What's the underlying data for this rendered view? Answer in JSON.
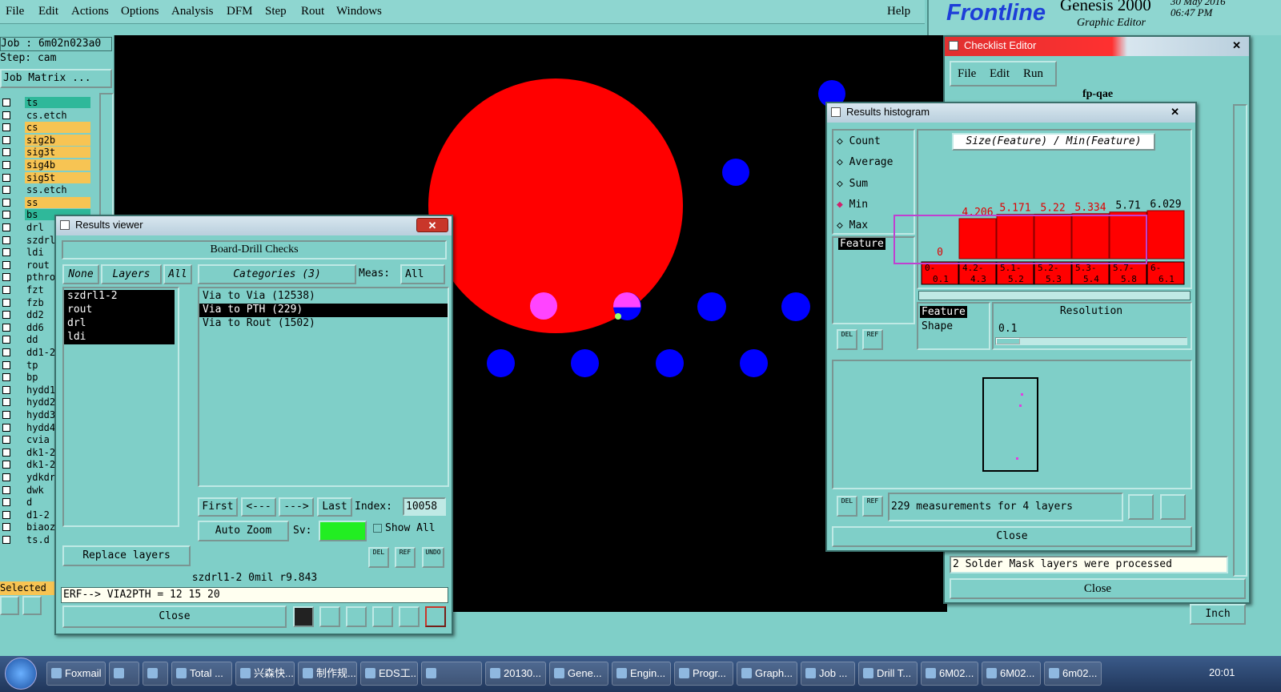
{
  "menu": [
    "File",
    "Edit",
    "Actions",
    "Options",
    "Analysis",
    "DFM",
    "Step",
    "Rout",
    "Windows"
  ],
  "help": "Help",
  "logo": {
    "brand": "Frontline",
    "product": "Genesis 2000",
    "subtitle": "Graphic Editor",
    "date": "30 May 2016",
    "time": "06:47 PM"
  },
  "job": {
    "job_label": "Job : 6m02n023a0",
    "step_label": "Step: cam",
    "matrix_btn": "Job Matrix ..."
  },
  "layers": [
    {
      "name": "ts",
      "color": "#2fb89a"
    },
    {
      "name": "cs.etch",
      "color": "#7fcfc8"
    },
    {
      "name": "cs",
      "color": "#f7c453"
    },
    {
      "name": "sig2b",
      "color": "#f7c453"
    },
    {
      "name": "sig3t",
      "color": "#f7c453"
    },
    {
      "name": "sig4b",
      "color": "#f7c453"
    },
    {
      "name": "sig5t",
      "color": "#f7c453"
    },
    {
      "name": "ss.etch",
      "color": "#7fcfc8"
    },
    {
      "name": "ss",
      "color": "#f7c453"
    },
    {
      "name": "bs",
      "color": "#2fb89a"
    },
    {
      "name": "drl",
      "color": "#7fcfc8"
    },
    {
      "name": "szdrl",
      "color": "#7fcfc8"
    },
    {
      "name": "ldi",
      "color": "#7fcfc8"
    },
    {
      "name": "rout",
      "color": "#7fcfc8"
    },
    {
      "name": "pthro",
      "color": "#7fcfc8"
    },
    {
      "name": "fzt",
      "color": "#7fcfc8"
    },
    {
      "name": "fzb",
      "color": "#7fcfc8"
    },
    {
      "name": "dd2",
      "color": "#7fcfc8"
    },
    {
      "name": "dd6",
      "color": "#7fcfc8"
    },
    {
      "name": "dd",
      "color": "#7fcfc8"
    },
    {
      "name": "dd1-2",
      "color": "#7fcfc8"
    },
    {
      "name": "tp",
      "color": "#7fcfc8"
    },
    {
      "name": "bp",
      "color": "#7fcfc8"
    },
    {
      "name": "hydd1",
      "color": "#7fcfc8"
    },
    {
      "name": "hydd2",
      "color": "#7fcfc8"
    },
    {
      "name": "hydd3",
      "color": "#7fcfc8"
    },
    {
      "name": "hydd4",
      "color": "#7fcfc8"
    },
    {
      "name": "cvia",
      "color": "#7fcfc8"
    },
    {
      "name": "dk1-2",
      "color": "#7fcfc8"
    },
    {
      "name": "dk1-2",
      "color": "#7fcfc8"
    },
    {
      "name": "ydkdr",
      "color": "#7fcfc8"
    },
    {
      "name": "dwk",
      "color": "#7fcfc8"
    },
    {
      "name": "d",
      "color": "#7fcfc8"
    },
    {
      "name": "d1-2",
      "color": "#7fcfc8"
    },
    {
      "name": "biaoz",
      "color": "#7fcfc8"
    },
    {
      "name": "ts.d",
      "color": "#7fcfc8"
    }
  ],
  "selected_label": "Selected :",
  "results_viewer": {
    "title": "Results viewer",
    "header": "Board-Drill Checks",
    "none": "None",
    "layers": "Layers",
    "all": "All",
    "layer_items": [
      "szdrl1-2",
      "rout",
      "drl",
      "ldi"
    ],
    "categories": "Categories (3)",
    "meas_label": "Meas:",
    "meas_value": "All",
    "category_items": [
      "Via to Via  (12538)",
      "Via to PTH  (229)",
      "Via to Rout  (1502)"
    ],
    "first": "First",
    "prev": "<---",
    "next": "--->",
    "last": "Last",
    "index_label": "Index:",
    "index_value": "10058",
    "replace": "Replace layers",
    "auto_zoom": "Auto Zoom",
    "sv": "Sv:",
    "show_all": "Show All",
    "status": "szdrl1-2 0mil  r9.843",
    "erf": "ERF--> VIA2PTH = 12 15 20",
    "close": "Close",
    "del": "DEL",
    "ref": "REF",
    "undo": "UNDO"
  },
  "checklist": {
    "title": "Checklist Editor",
    "menu": [
      "File",
      "Edit",
      "Run"
    ],
    "name": "fp-qae",
    "message": "2 Solder Mask layers were processed",
    "close": "Close",
    "units": "Inch"
  },
  "histogram": {
    "title": "Results histogram",
    "modes": [
      "Count",
      "Average",
      "Sum",
      "Min",
      "Max"
    ],
    "selected_mode": "Min",
    "expression": "Size(Feature) / Min(Feature)",
    "feature_label": "Feature",
    "feature2": "Feature",
    "shape": "Shape",
    "resolution_label": "Resolution",
    "resolution_value": "0.1",
    "summary": "229 measurements for 4 layers",
    "close": "Close",
    "del": "DEL",
    "ref": "REF"
  },
  "chart_data": {
    "type": "bar",
    "categories": [
      "0-0.1",
      "4.2-4.3",
      "5.1-5.2",
      "5.2-5.3",
      "5.3-5.4",
      "5.7-5.8",
      "6-6.1"
    ],
    "values": [
      0,
      4.206,
      5.171,
      5.22,
      5.334,
      5.71,
      6.029
    ],
    "title": "Size(Feature) / Min(Feature)",
    "xlabel": "",
    "ylabel": ""
  },
  "taskbar": [
    "Foxmail",
    "",
    "",
    "Total ...",
    "兴森快...",
    "制作规...",
    "EDS工...",
    "",
    "20130...",
    "Gene...",
    "Engin...",
    "Progr...",
    "Graph...",
    "Job ...",
    "Drill T...",
    "6M02...",
    "6M02...",
    "6m02..."
  ],
  "clock": "20:01"
}
